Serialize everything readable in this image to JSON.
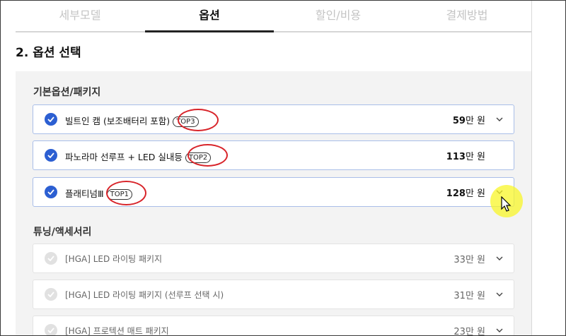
{
  "tabs": [
    {
      "label": "세부모델",
      "active": false
    },
    {
      "label": "옵션",
      "active": true
    },
    {
      "label": "할인/비용",
      "active": false
    },
    {
      "label": "결제방법",
      "active": false
    }
  ],
  "section_title": "2. 옵션 선택",
  "basic": {
    "title": "기본옵션/패키지",
    "items": [
      {
        "label": "빌트인 캠 (보조배터리 포함)",
        "badge": "TOP3",
        "price_num": "59",
        "price_unit": "만 원",
        "checked": true,
        "has_chevron": true
      },
      {
        "label": "파노라마 선루프 + LED 실내등",
        "badge": "TOP2",
        "price_num": "113",
        "price_unit": "만 원",
        "checked": true,
        "has_chevron": false
      },
      {
        "label": "플래티넘Ⅲ",
        "badge": "TOP1",
        "price_num": "128",
        "price_unit": "만 원",
        "checked": true,
        "has_chevron": true
      }
    ]
  },
  "tuning": {
    "title": "튜닝/액세서리",
    "items": [
      {
        "label": "[HGA] LED 라이팅 패키지",
        "price_num": "33",
        "price_unit": "만 원",
        "checked": false
      },
      {
        "label": "[HGA] LED 라이팅 패키지 (선루프 선택 시)",
        "price_num": "31",
        "price_unit": "만 원",
        "checked": false
      },
      {
        "label": "[HGA] 프로텍션 매트 패키지",
        "price_num": "23",
        "price_unit": "만 원",
        "checked": false
      }
    ]
  },
  "colors": {
    "check_on": "#2c5fd2",
    "annotation_red": "#d8242a",
    "cursor_highlight": "#f8f528"
  },
  "icons": [
    "check-icon",
    "chevron-down-icon",
    "mouse-cursor-icon"
  ]
}
